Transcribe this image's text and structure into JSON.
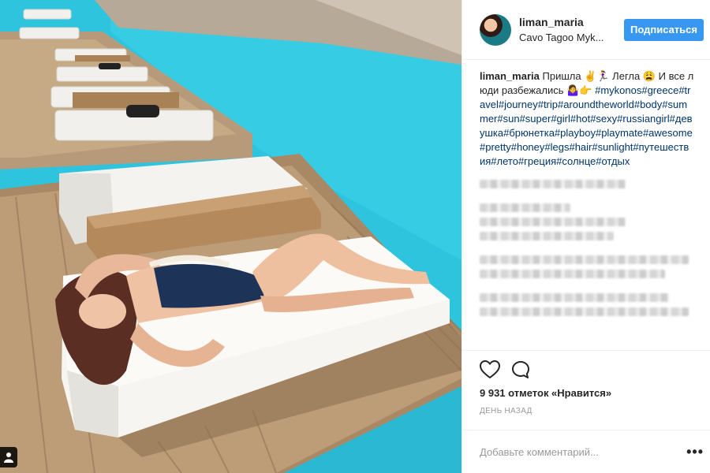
{
  "post": {
    "username": "liman_maria",
    "location": "Cavo Tagoo Myk...",
    "follow_label": "Подписаться",
    "caption_text": "Пришла ✌️🏃‍♀️ Легла 😩 И все люди разбежались 🤷‍♀️👉",
    "hashtags": "#mykonos#greece#travel#journey#trip#aroundtheworld#body#summer#sun#super#girl#hot#sexy#russiangirl#девушка#брюнетка#playboy#playmate#awesome#pretty#honey#legs#hair#sunlight#путешествия#лето#греция#солнце#отдых",
    "likes": "9 931 отметок «Нравится»",
    "time": "ДЕНЬ НАЗАД",
    "comment_placeholder": "Добавьте комментарий...",
    "more_label": "•••"
  },
  "icons": {
    "like": "heart-icon",
    "comment": "comment-icon",
    "more": "more-icon",
    "tag": "user-tag-icon"
  },
  "colors": {
    "follow_button": "#3897f0",
    "hashtag": "#003569",
    "pool": "#2fc6df"
  }
}
